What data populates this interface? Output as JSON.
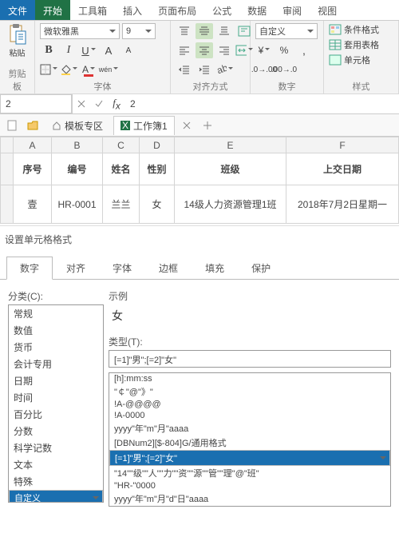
{
  "tabs": {
    "file": "文件",
    "start": "开始",
    "toolbox": "工具箱",
    "insert": "插入",
    "layout": "页面布局",
    "formula": "公式",
    "data": "数据",
    "review": "审阅",
    "view": "视图"
  },
  "ribbon": {
    "font": {
      "name": "微软雅黑",
      "size": "9",
      "group": "字体"
    },
    "clipboard": {
      "group": "剪贴板"
    },
    "align": {
      "group": "对齐方式"
    },
    "number": {
      "format": "自定义",
      "group": "数字"
    },
    "styles": {
      "group": "样式",
      "cf": "条件格式",
      "tbl": "套用表格",
      "cell": "单元格"
    }
  },
  "namebox": "2",
  "formula_value": "2",
  "wb": {
    "template": "模板专区",
    "book": "工作簿1"
  },
  "cols": [
    "A",
    "B",
    "C",
    "D",
    "E",
    "F"
  ],
  "headers": {
    "a": "序号",
    "b": "编号",
    "c": "姓名",
    "d": "性别",
    "e": "班级",
    "f": "上交日期"
  },
  "row": {
    "a": "壹",
    "b": "HR-0001",
    "c": "兰兰",
    "d": "女",
    "e": "14级人力资源管理1班",
    "f": "2018年7月2日星期一"
  },
  "dlg": {
    "title": "设置单元格格式",
    "tabs": {
      "number": "数字",
      "align": "对齐",
      "font": "字体",
      "border": "边框",
      "fill": "填充",
      "protect": "保护"
    },
    "cat_label": "分类(C):",
    "cats": [
      "常规",
      "数值",
      "货币",
      "会计专用",
      "日期",
      "时间",
      "百分比",
      "分数",
      "科学记数",
      "文本",
      "特殊",
      "自定义"
    ],
    "cat_selected": "自定义",
    "example_label": "示例",
    "example_value": "女",
    "type_label": "类型(T):",
    "type_value": "[=1]\"男\";[=2]\"女\"",
    "types": [
      "[h]:mm:ss",
      "\"￠\"@\"》\"",
      "!A-@@@@",
      "!A-0000",
      "yyyy\"年\"m\"月\"aaaa",
      "[DBNum2][$-804]G/通用格式",
      "[=1]\"男\";[=2]\"女\"",
      "\"14\"\"级\"\"人\"\"力\"\"资\"\"源\"\"管\"\"理\"@\"班\"",
      "\"HR-\"0000",
      "yyyy\"年\"m\"月\"d\"日\"aaaa"
    ],
    "type_sel_index": 6
  }
}
